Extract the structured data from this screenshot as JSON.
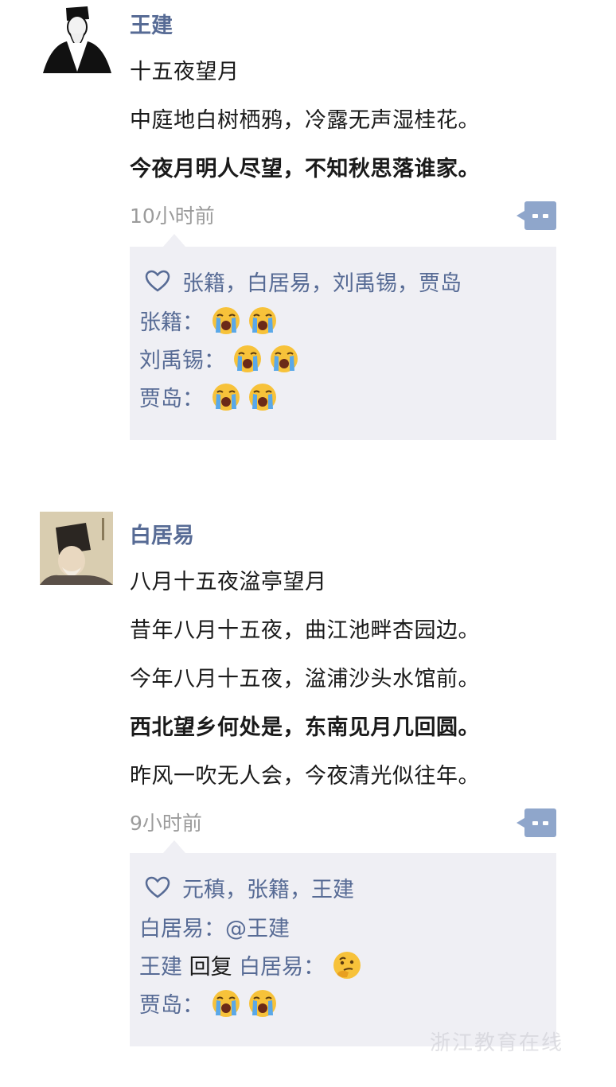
{
  "posts": [
    {
      "author": "王建",
      "lines": [
        "十五夜望月",
        "中庭地白树栖鸦，冷露无声湿桂花。",
        "今夜月明人尽望，不知秋思落谁家。"
      ],
      "time": "10小时前",
      "likes": "张籍，白居易，刘禹锡，贾岛",
      "comments": [
        {
          "name": "张籍：",
          "emoji": [
            "loudly-crying-face",
            "loudly-crying-face"
          ]
        },
        {
          "name": "刘禹锡：",
          "emoji": [
            "loudly-crying-face",
            "loudly-crying-face"
          ]
        },
        {
          "name": "贾岛：",
          "emoji": [
            "loudly-crying-face",
            "loudly-crying-face"
          ]
        }
      ]
    },
    {
      "author": "白居易",
      "lines": [
        "八月十五夜湓亭望月",
        "昔年八月十五夜，曲江池畔杏园边。",
        "今年八月十五夜，湓浦沙头水馆前。",
        "西北望乡何处是，东南见月几回圆。",
        "昨风一吹无人会，今夜清光似往年。"
      ],
      "time": "9小时前",
      "likes": "元稹，张籍，王建",
      "comments": [
        {
          "name": "白居易：",
          "text": "@王建"
        },
        {
          "name": "王建",
          "reply_word": "回复",
          "reply_to": "白居易：",
          "emoji": [
            "thinking-face"
          ]
        },
        {
          "name": "贾岛：",
          "emoji": [
            "loudly-crying-face",
            "loudly-crying-face"
          ]
        }
      ]
    }
  ],
  "watermark": "浙江教育在线",
  "colors": {
    "name_blue": "#576b95",
    "time_gray": "#9b9b9b",
    "box_bg": "#efeff4",
    "more_button": "#8fa6cb"
  }
}
